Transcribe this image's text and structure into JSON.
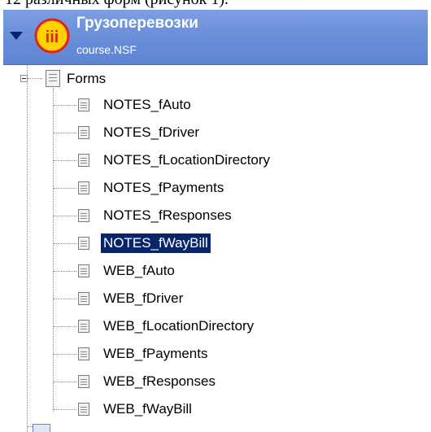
{
  "caption_fragment": "12 различных форм (рисунок 1).",
  "database": {
    "title": "Грузоперевозки",
    "file": "course.NSF",
    "logo_text": "iii",
    "colors": {
      "header_top": "#7d9ee3",
      "header_bottom": "#5e84d2",
      "logo_fill": "#ffd200",
      "logo_ring": "#e2231a",
      "selection": "#0a246a"
    }
  },
  "tree": {
    "root_label": "Forms",
    "root_expanded": true,
    "items": [
      {
        "label": "NOTES_fAuto",
        "selected": false
      },
      {
        "label": "NOTES_fDriver",
        "selected": false
      },
      {
        "label": "NOTES_fLocationDirectory",
        "selected": false
      },
      {
        "label": "NOTES_fPayments",
        "selected": false
      },
      {
        "label": "NOTES_fResponses",
        "selected": false
      },
      {
        "label": "NOTES_fWayBill",
        "selected": true
      },
      {
        "label": "WEB_fAuto",
        "selected": false
      },
      {
        "label": "WEB_fDriver",
        "selected": false
      },
      {
        "label": "WEB_fLocationDirectory",
        "selected": false
      },
      {
        "label": "WEB_fPayments",
        "selected": false
      },
      {
        "label": "WEB_fResponses",
        "selected": false
      },
      {
        "label": "WEB_fWayBill",
        "selected": false
      }
    ]
  },
  "icons": {
    "collapse": "triangle-down-icon",
    "logo": "database-logo-icon",
    "form": "form-document-icon",
    "expander": "minus-box-icon"
  }
}
